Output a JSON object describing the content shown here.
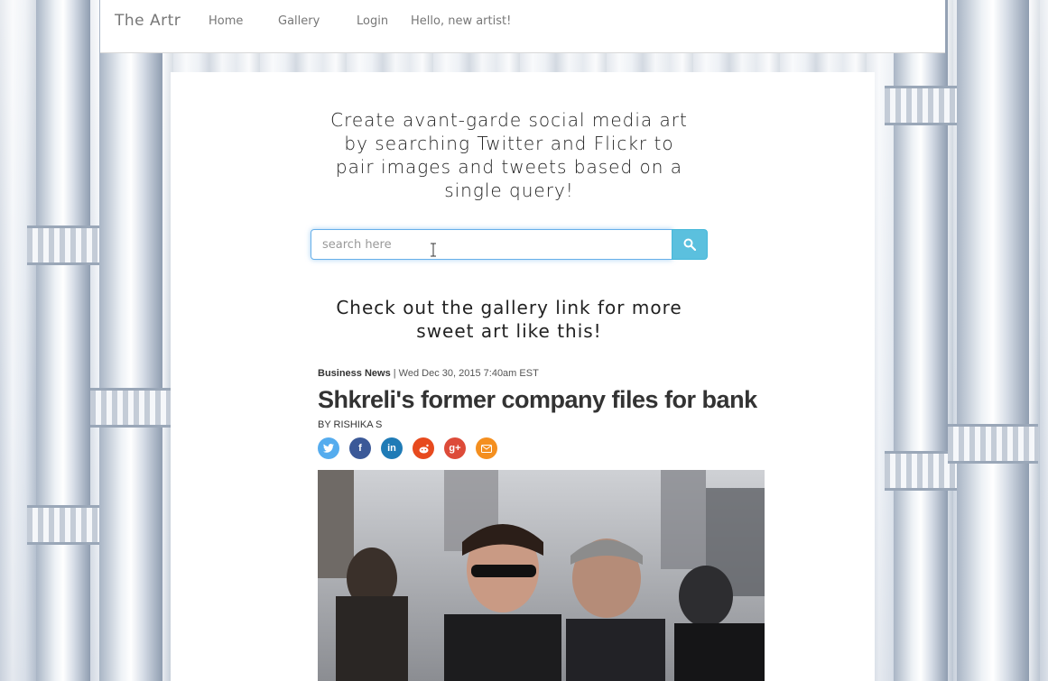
{
  "navbar": {
    "brand": "The Artr",
    "links": [
      "Home",
      "Gallery",
      "Login",
      "Hello, new artist!"
    ]
  },
  "hero": {
    "tagline": "Create avant-garde social media art by searching Twitter and Flickr to pair images and tweets based on a single query!",
    "search_placeholder": "search here",
    "gallery_note": "Check out the gallery link for more sweet art like this!"
  },
  "article": {
    "section": "Business News",
    "date": "| Wed Dec 30, 2015 7:40am EST",
    "headline": "Shkreli's former company files for bank",
    "byline": "BY RISHIKA S",
    "share_icons": [
      "twitter-icon",
      "facebook-icon",
      "linkedin-icon",
      "reddit-icon",
      "google-plus-icon",
      "email-icon"
    ],
    "share_colors": [
      "#55acee",
      "#3b5998",
      "#1f7bb6",
      "#e74a1e",
      "#dd4b39",
      "#f48f1f"
    ]
  },
  "colors": {
    "search_button": "#5bc0de",
    "focus_border": "#66afe9"
  }
}
